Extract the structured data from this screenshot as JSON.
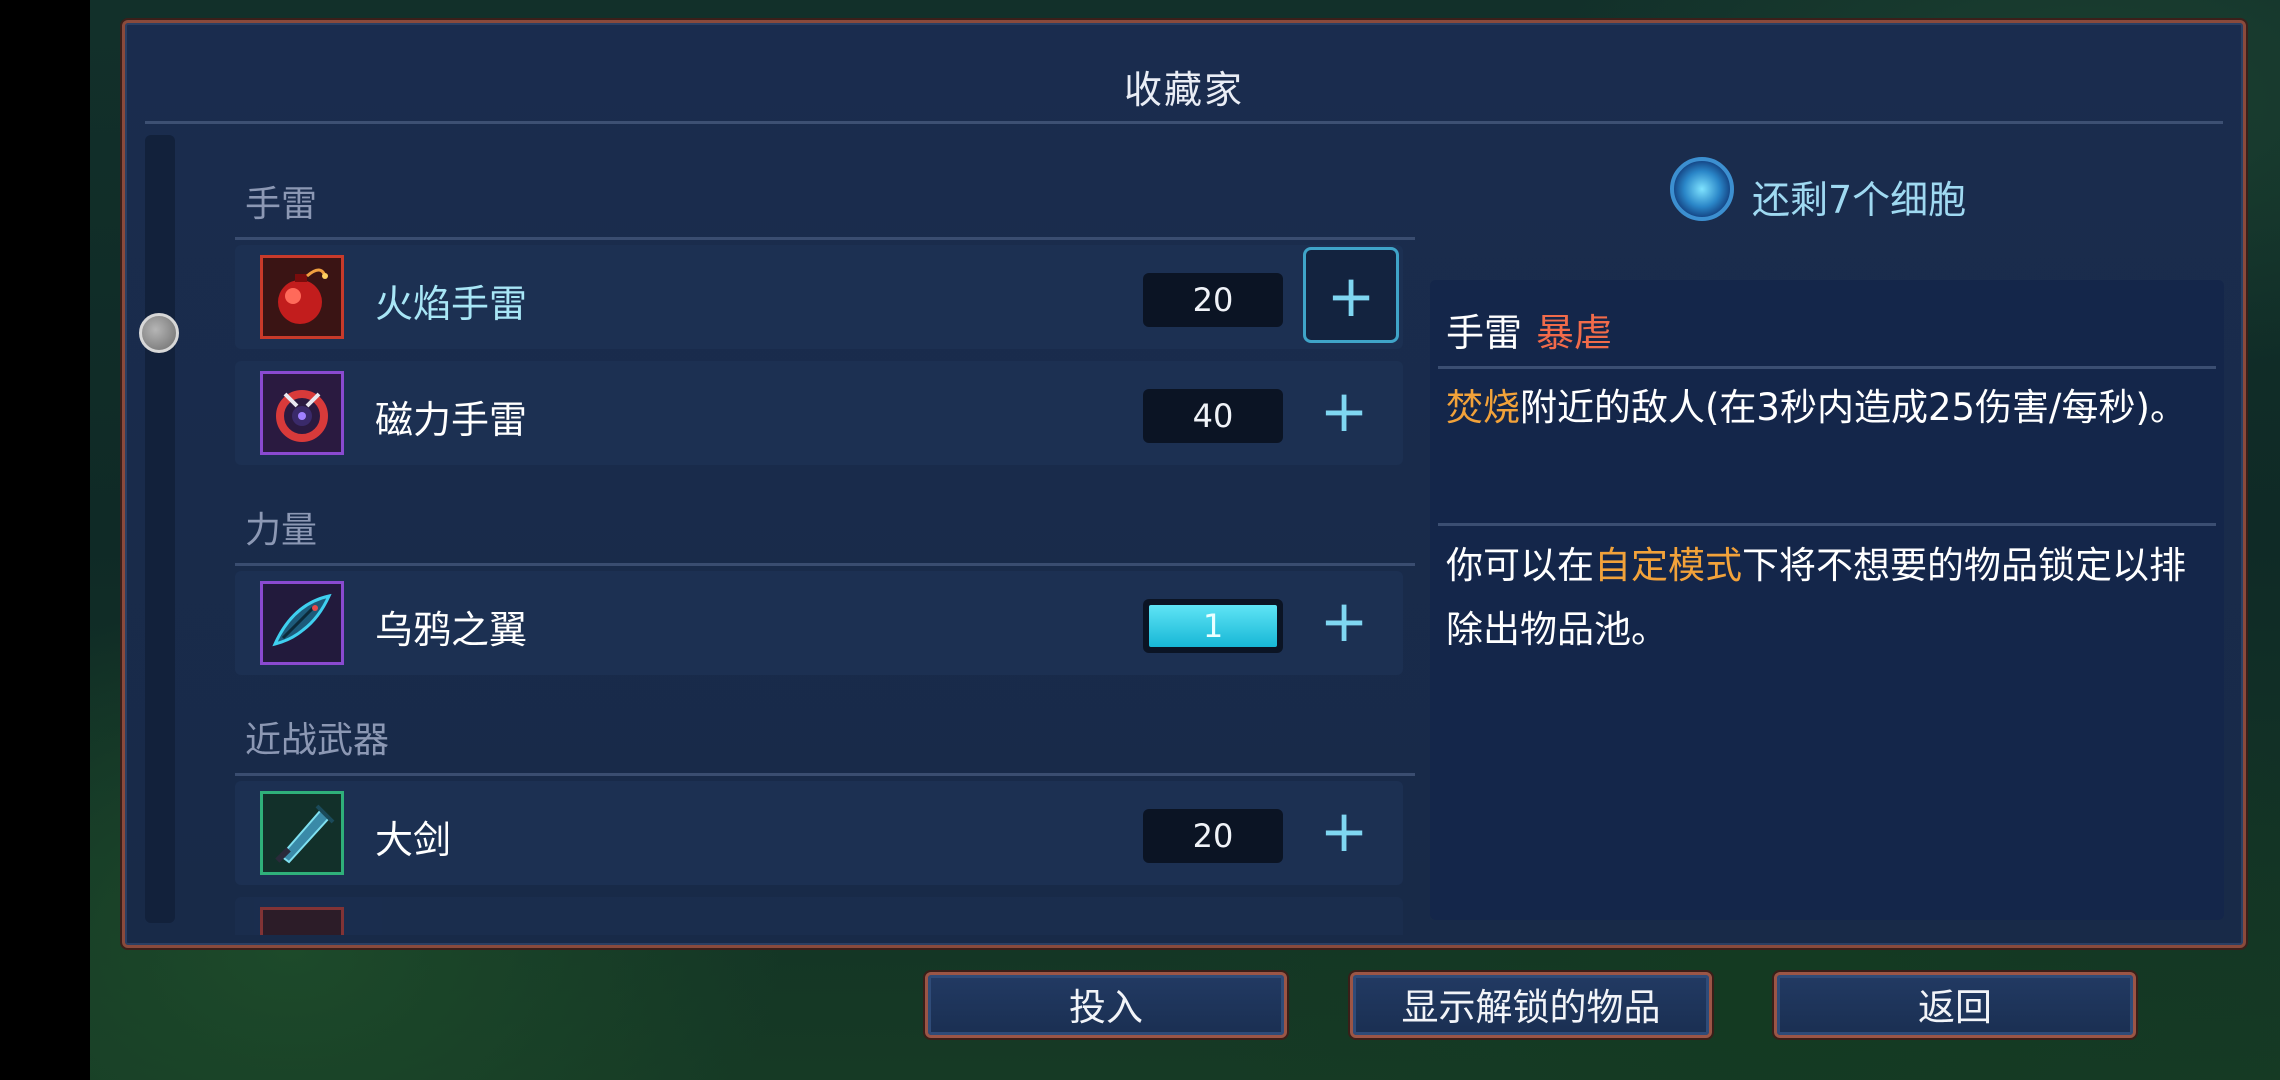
{
  "panel": {
    "title": "收藏家"
  },
  "categories": [
    {
      "label": "手雷"
    },
    {
      "label": "力量"
    },
    {
      "label": "近战武器"
    }
  ],
  "items": [
    {
      "name": "火焰手雷",
      "cost": "20",
      "icon": "fire-grenade-icon",
      "border_color": "#c83a2a"
    },
    {
      "name": "磁力手雷",
      "cost": "40",
      "icon": "magnetic-grenade-icon",
      "border_color": "#8a4ad0"
    },
    {
      "name": "乌鸦之翼",
      "cost": "1",
      "icon": "ravens-wing-icon",
      "border_color": "#8a4ad0"
    },
    {
      "name": "大剑",
      "cost": "20",
      "icon": "broadsword-icon",
      "border_color": "#2fb07a"
    }
  ],
  "plus_label": "+",
  "cells": {
    "text": "还剩7个细胞"
  },
  "info": {
    "type": "手雷",
    "tag": "暴虐",
    "desc_highlight": "焚烧",
    "desc_rest": "附近的敌人(在3秒内造成25伤害/每秒)。",
    "note_pre": "你可以在",
    "note_highlight": "自定模式",
    "note_post": "下将不想要的物品锁定以排除出物品池。"
  },
  "buttons": {
    "invest": "投入",
    "show_unlocked": "显示解锁的物品",
    "back": "返回"
  },
  "colors": {
    "accent_cyan": "#7fd6f1",
    "tag_red": "#f26b4a",
    "highlight_orange": "#f2a23a",
    "panel_border": "#8a4a3c"
  }
}
